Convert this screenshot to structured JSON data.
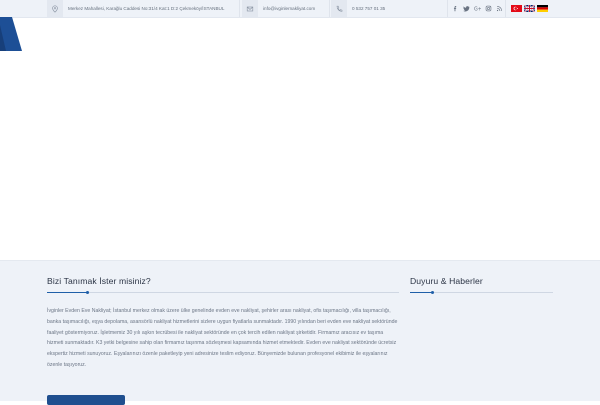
{
  "topbar": {
    "address": "Merkez Mahallesi, Karağlu Caddesi No:31/4 Kat:1 D:2 Çekmeköy/İSTANBUL",
    "email": "info@ivginlernakliyat.com",
    "phone": "0 532 757 01 35",
    "social_icons": [
      "facebook-icon",
      "twitter-icon",
      "google-plus-icon",
      "instagram-icon",
      "rss-icon"
    ],
    "languages": [
      "tr-flag-icon",
      "en-flag-icon",
      "de-flag-icon"
    ]
  },
  "colors": {
    "accent": "#1f5fa8",
    "topbar_bg": "#eef2f8",
    "footer_bg": "#eef2f8",
    "button": "#1f4f8f"
  },
  "about": {
    "title": "Bizi Tanımak İster misiniz?",
    "text": "İvginler Evden Eve Nakliyat; İstanbul merkez olmak üzere ülke genelinde evden eve nakliyat, şehirler arası nakliyat, ofis taşımacılığı, villa taşımacılığı, banka taşımacılığı, eşya depolama, asansörlü nakliyat hizmetlerini sizlere uygun fiyatlarla sunmaktadır. 1990 yılından beri evden eve nakliyat sektöründe faaliyet göstermiyoruz. İşletmemiz 30 yılı aşkın tecrübesi ile nakliyat sektöründe en çok tercih edilen nakliyat şirketidir. Firmamız aracısız ev taşıma hizmeti sunmaktadır. K3 yetki belgesine sahip olan firmamız taşınma sözleşmesi kapsamında hizmet etmektedir. Evden eve nakliyat sektöründe ücretsiz ekspertiz hizmeti sunuyoruz. Eşyalarınızı özenle paketleyip yeni adresinize teslim ediyoruz. Bünyemizde bulunan profesyonel ekibimiz ile eşyalarınız özenle taşıyoruz."
  },
  "news": {
    "title": "Duyuru & Haberler"
  }
}
